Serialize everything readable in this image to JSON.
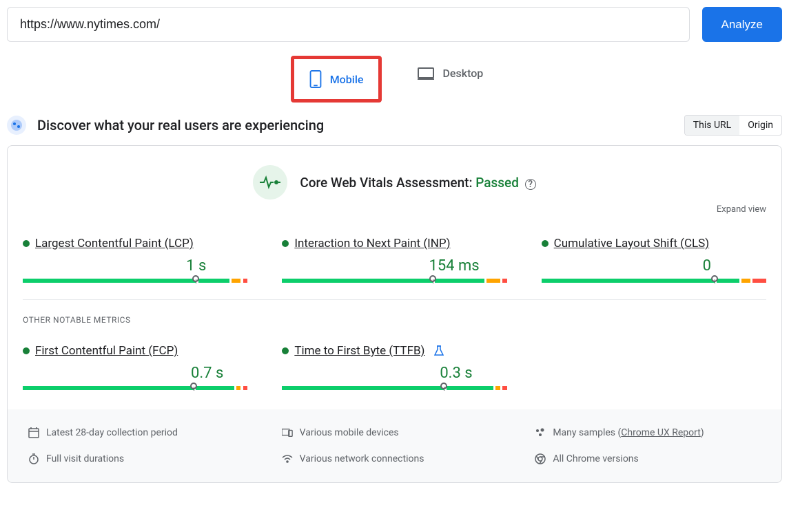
{
  "top": {
    "url": "https://www.nytimes.com/",
    "analyze_label": "Analyze"
  },
  "tabs": {
    "mobile": "Mobile",
    "desktop": "Desktop"
  },
  "section": {
    "title": "Discover what your real users are experiencing",
    "toggle_this": "This URL",
    "toggle_origin": "Origin"
  },
  "assessment": {
    "prefix": "Core Web Vitals Assessment: ",
    "status": "Passed",
    "expand": "Expand view"
  },
  "metrics": {
    "lcp": {
      "label": "Largest Contentful Paint (LCP)",
      "value": "1 s",
      "marker_pct": 77,
      "segments": [
        77,
        1,
        14,
        1,
        4,
        1,
        2
      ]
    },
    "inp": {
      "label": "Interaction to Next Paint (INP)",
      "value": "154 ms",
      "marker_pct": 67,
      "segments": [
        67,
        1,
        22,
        1,
        6,
        1,
        2
      ]
    },
    "cls": {
      "label": "Cumulative Layout Shift (CLS)",
      "value": "0",
      "marker_pct": 77,
      "segments": [
        77,
        1,
        10,
        1,
        4,
        1,
        6
      ]
    },
    "fcp": {
      "label": "First Contentful Paint (FCP)",
      "value": "0.7 s",
      "marker_pct": 76,
      "segments": [
        76,
        1,
        17,
        1,
        2,
        1,
        2
      ]
    },
    "ttfb": {
      "label": "Time to First Byte (TTFB)",
      "value": "0.3 s",
      "marker_pct": 72,
      "segments": [
        72,
        1,
        21,
        1,
        2,
        1,
        2
      ]
    }
  },
  "other_label": "OTHER NOTABLE METRICS",
  "footer": {
    "collection": "Latest 28-day collection period",
    "devices": "Various mobile devices",
    "samples_prefix": "Many samples (",
    "samples_link": "Chrome UX Report",
    "samples_suffix": ")",
    "durations": "Full visit durations",
    "network": "Various network connections",
    "versions": "All Chrome versions"
  }
}
